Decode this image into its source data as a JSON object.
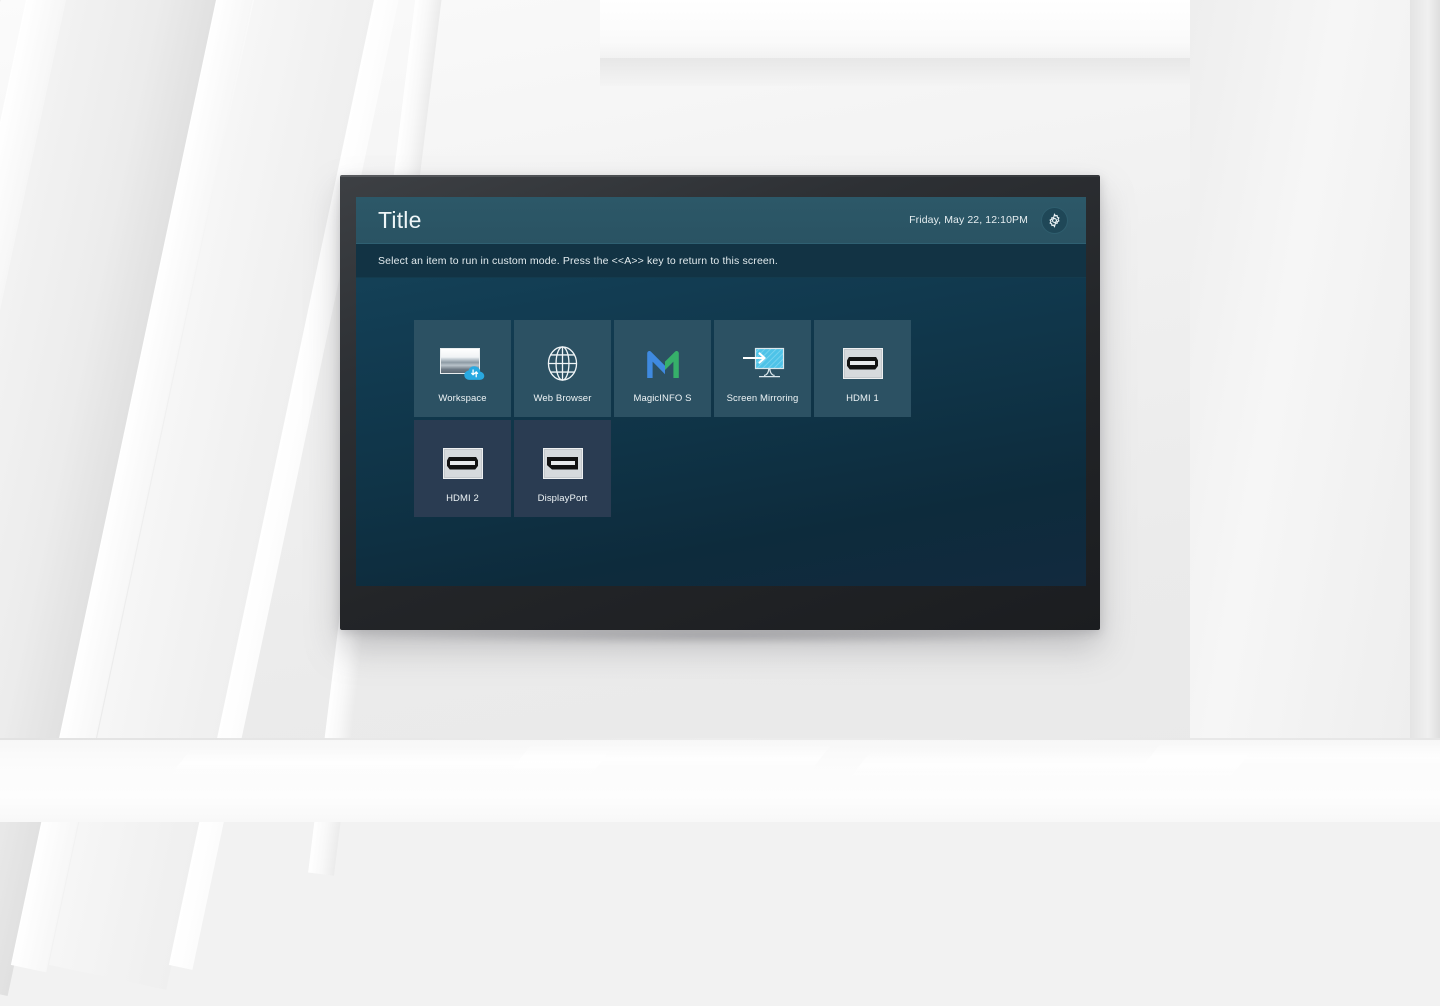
{
  "screen": {
    "header": {
      "title": "Title",
      "datetime": "Friday, May 22, 12:10PM",
      "settings_icon": "gear-icon"
    },
    "instruction": "Select an item to run in custom mode. Press the <<A>> key to return to this screen.",
    "rows": [
      {
        "tiles": [
          {
            "label": "Workspace",
            "icon": "workspace-cloud-icon",
            "style": "teal"
          },
          {
            "label": "Web Browser",
            "icon": "globe-icon",
            "style": "teal"
          },
          {
            "label": "MagicINFO S",
            "icon": "magicinfo-logo-icon",
            "style": "teal"
          },
          {
            "label": "Screen Mirroring",
            "icon": "screen-mirroring-icon",
            "style": "teal"
          },
          {
            "label": "HDMI 1",
            "icon": "hdmi-port-icon",
            "style": "teal"
          }
        ]
      },
      {
        "tiles": [
          {
            "label": "HDMI 2",
            "icon": "hdmi-port-icon",
            "style": "navy"
          },
          {
            "label": "DisplayPort",
            "icon": "displayport-port-icon",
            "style": "navy"
          }
        ]
      }
    ]
  },
  "colors": {
    "header_bar": "#2a5363",
    "instruction_bar": "#123344",
    "panel_background": "#0f3346",
    "tile_teal": "#2c5163",
    "tile_navy": "#2a3c52",
    "text_primary": "#eef4f6",
    "magicinfo_blue": "#3f8ae0",
    "magicinfo_green": "#36b06a",
    "mirroring_cyan": "#4ec3e8",
    "cloud_blue": "#2aaae2",
    "bezel": "#26282b"
  }
}
